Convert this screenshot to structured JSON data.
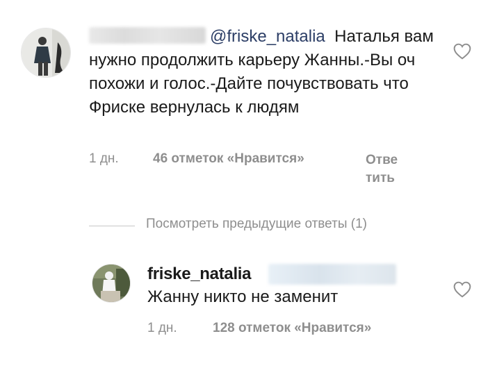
{
  "comment": {
    "mention": "@friske_natalia",
    "text": "Наталья вам нужно продолжить карьеру Жанны.-Вы оч похожи и голос.-Дайте почувствовать что Фриске вернулась к людям",
    "time": "1 дн.",
    "likes": "46 отметок «Нравится»",
    "reply_line1": "Отве",
    "reply_line2": "тить"
  },
  "view_replies": "Посмотреть предыдущие ответы (1)",
  "reply": {
    "username": "friske_natalia",
    "text": "Жанну никто не заменит",
    "time": "1 дн.",
    "likes": "128 отметок «Нравится»"
  },
  "colors": {
    "meta": "#8e8e8e",
    "mention": "#2c3e66",
    "text": "#1a1a1a"
  }
}
